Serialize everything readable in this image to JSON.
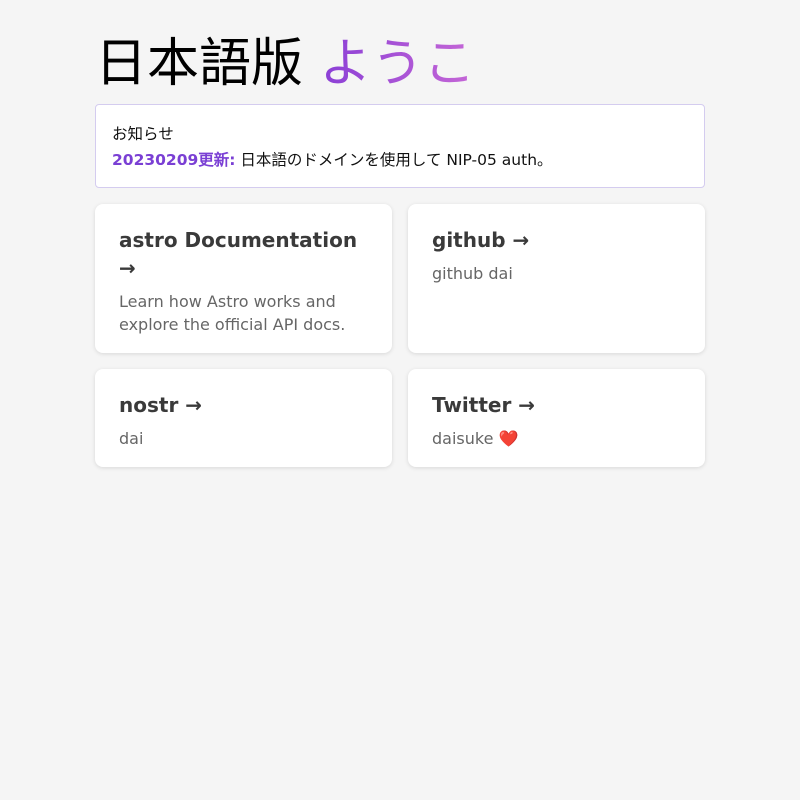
{
  "header": {
    "title_main": "日本語版",
    "title_accent": "ようこ"
  },
  "notice": {
    "heading": "お知らせ",
    "date": "20230209更新:",
    "message": "日本語のドメインを使用して NIP-05 auth。"
  },
  "cards": [
    {
      "title": "astro Documentation →",
      "description": "Learn how Astro works and explore the official API docs."
    },
    {
      "title": "github →",
      "description": "github dai"
    },
    {
      "title": "nostr →",
      "description": "dai"
    },
    {
      "title": "Twitter →",
      "description": "daisuke",
      "emoji": "❤️"
    }
  ]
}
